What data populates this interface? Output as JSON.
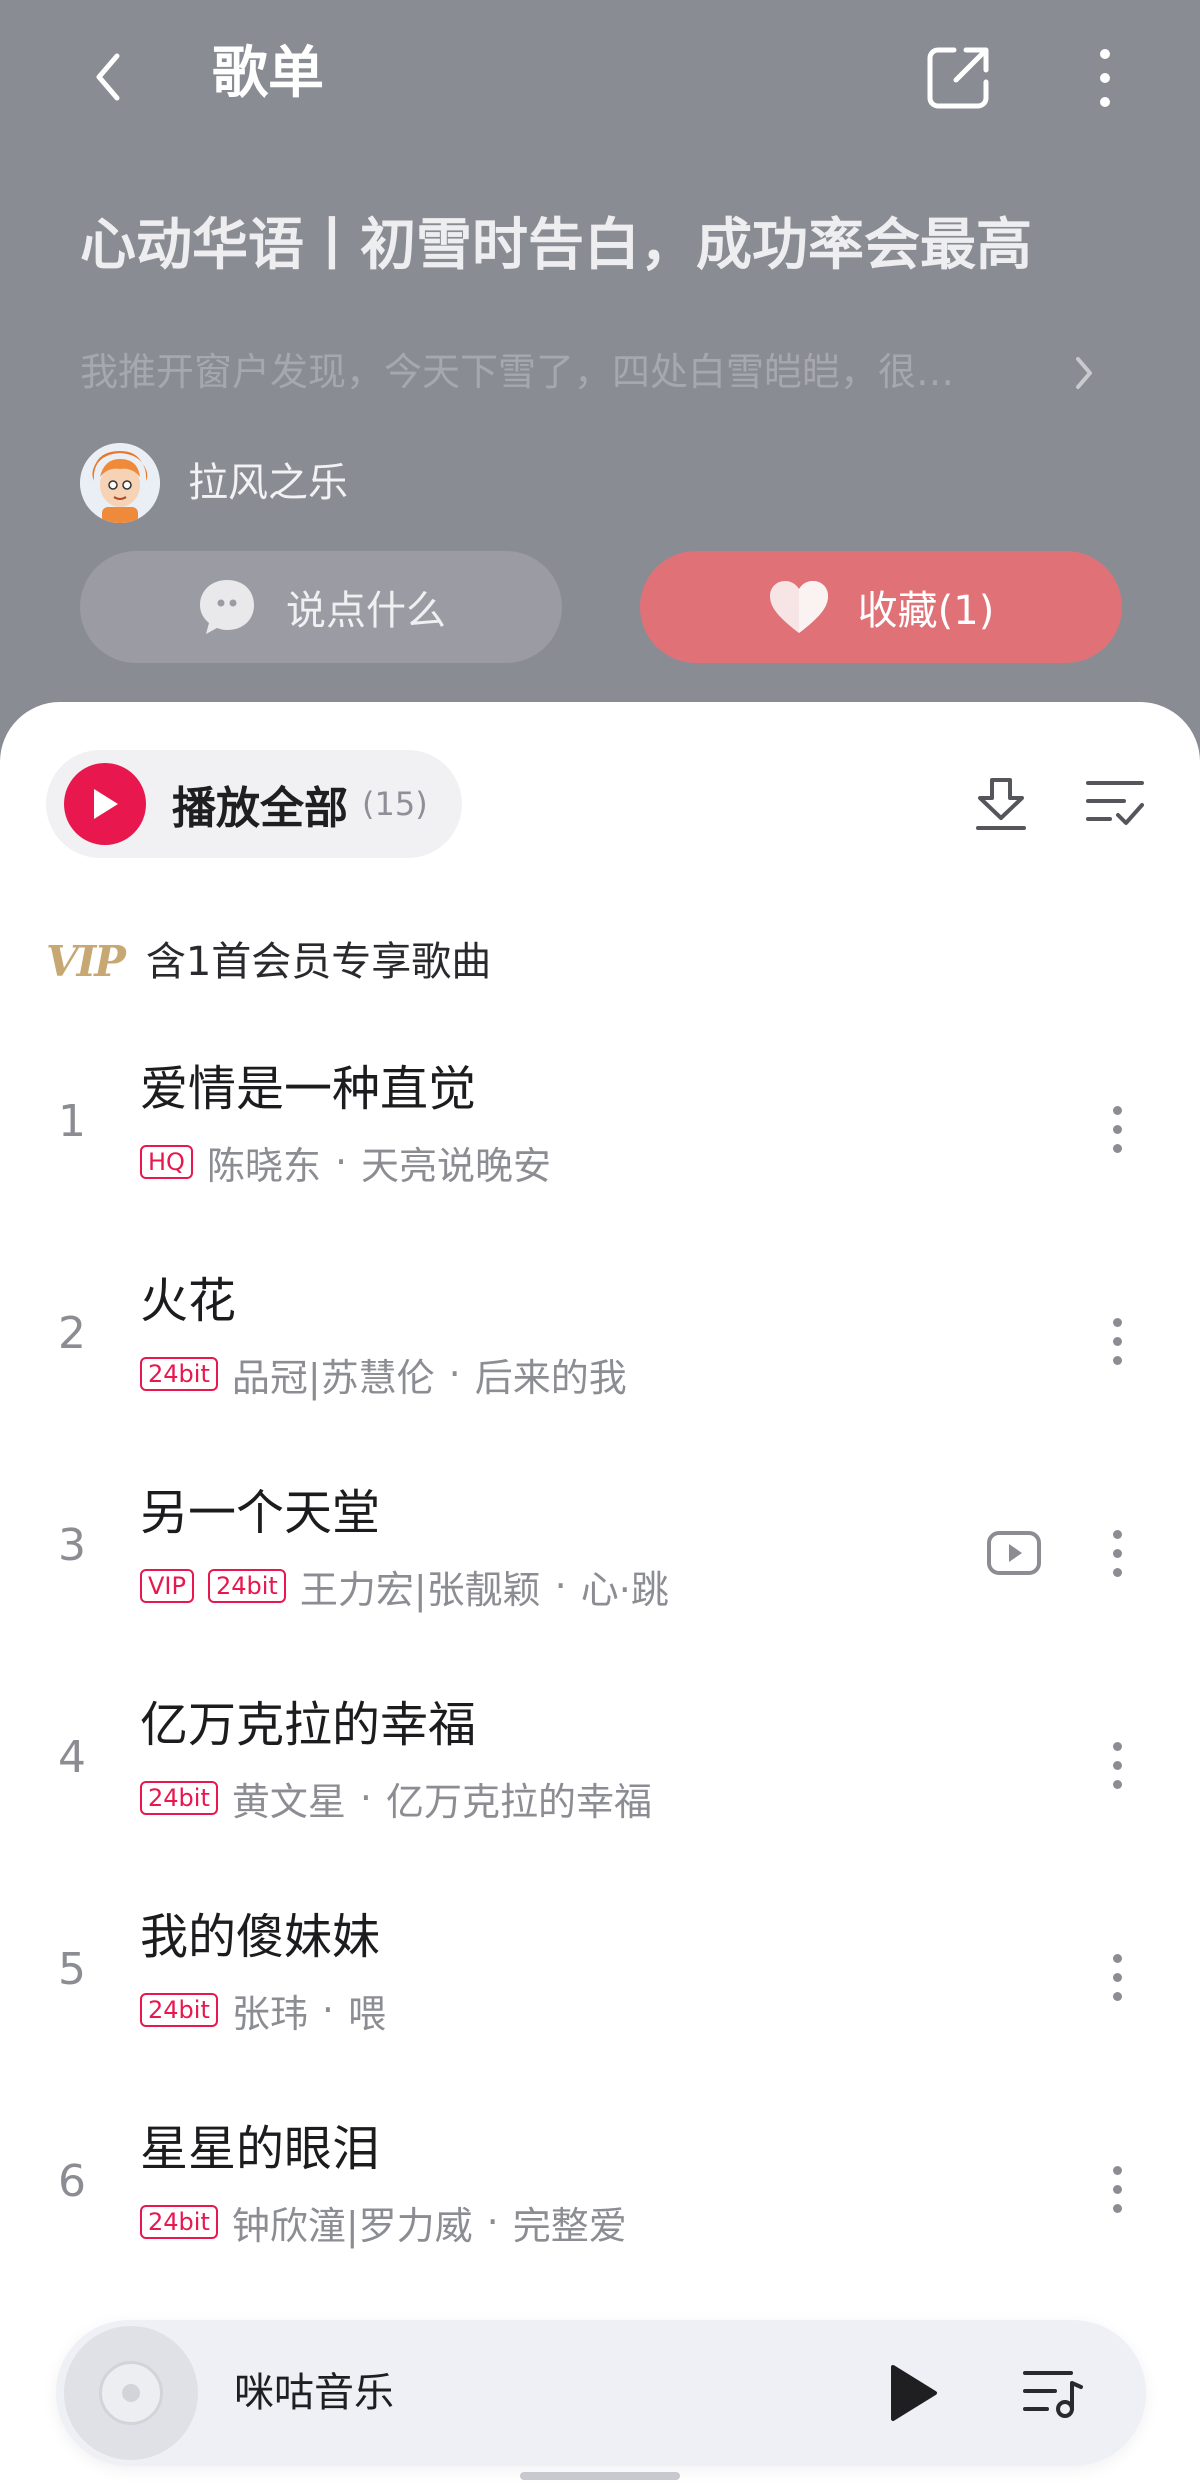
{
  "header": {
    "title": "歌单",
    "playlist_title": "心动华语丨初雪时告白，成功率会最高",
    "description": "我推开窗户发现，今天下雪了，四处白雪皑皑，很…",
    "creator_name": "拉风之乐",
    "comment_label": "说点什么",
    "collect_label": "收藏(1)",
    "bg_color": "#8a8c94",
    "collect_color": "#e07277"
  },
  "toolbar": {
    "play_all_label": "播放全部",
    "play_all_count": "(15)",
    "accent": "#e8174e"
  },
  "vip": {
    "logo": "VIP",
    "notice": "含1首会员专享歌曲"
  },
  "songs": [
    {
      "index": "1",
      "title": "爱情是一种直觉",
      "tags": [
        "HQ"
      ],
      "artist": "陈晓东",
      "album": "天亮说晚安",
      "has_mv": false
    },
    {
      "index": "2",
      "title": "火花",
      "tags": [
        "24bit"
      ],
      "artist": "品冠|苏慧伦",
      "album": "后来的我",
      "has_mv": false
    },
    {
      "index": "3",
      "title": "另一个天堂",
      "tags": [
        "VIP",
        "24bit"
      ],
      "artist": "王力宏|张靓颖",
      "album": "心·跳",
      "has_mv": true
    },
    {
      "index": "4",
      "title": "亿万克拉的幸福",
      "tags": [
        "24bit"
      ],
      "artist": "黄文星",
      "album": "亿万克拉的幸福",
      "has_mv": false
    },
    {
      "index": "5",
      "title": "我的傻妹妹",
      "tags": [
        "24bit"
      ],
      "artist": "张玮",
      "album": "喂",
      "has_mv": false
    },
    {
      "index": "6",
      "title": "星星的眼泪",
      "tags": [
        "24bit"
      ],
      "artist": "钟欣潼|罗力威",
      "album": "完整爱",
      "has_mv": false
    }
  ],
  "mini_player": {
    "title": "咪咕音乐"
  },
  "icons": [
    "back-icon",
    "share-icon",
    "more-icon",
    "chevron-right-icon",
    "chat-bubble-icon",
    "heart-icon",
    "play-icon",
    "download-icon",
    "multiselect-icon",
    "song-more-icon",
    "mv-icon",
    "disc-icon",
    "playlist-queue-icon"
  ]
}
